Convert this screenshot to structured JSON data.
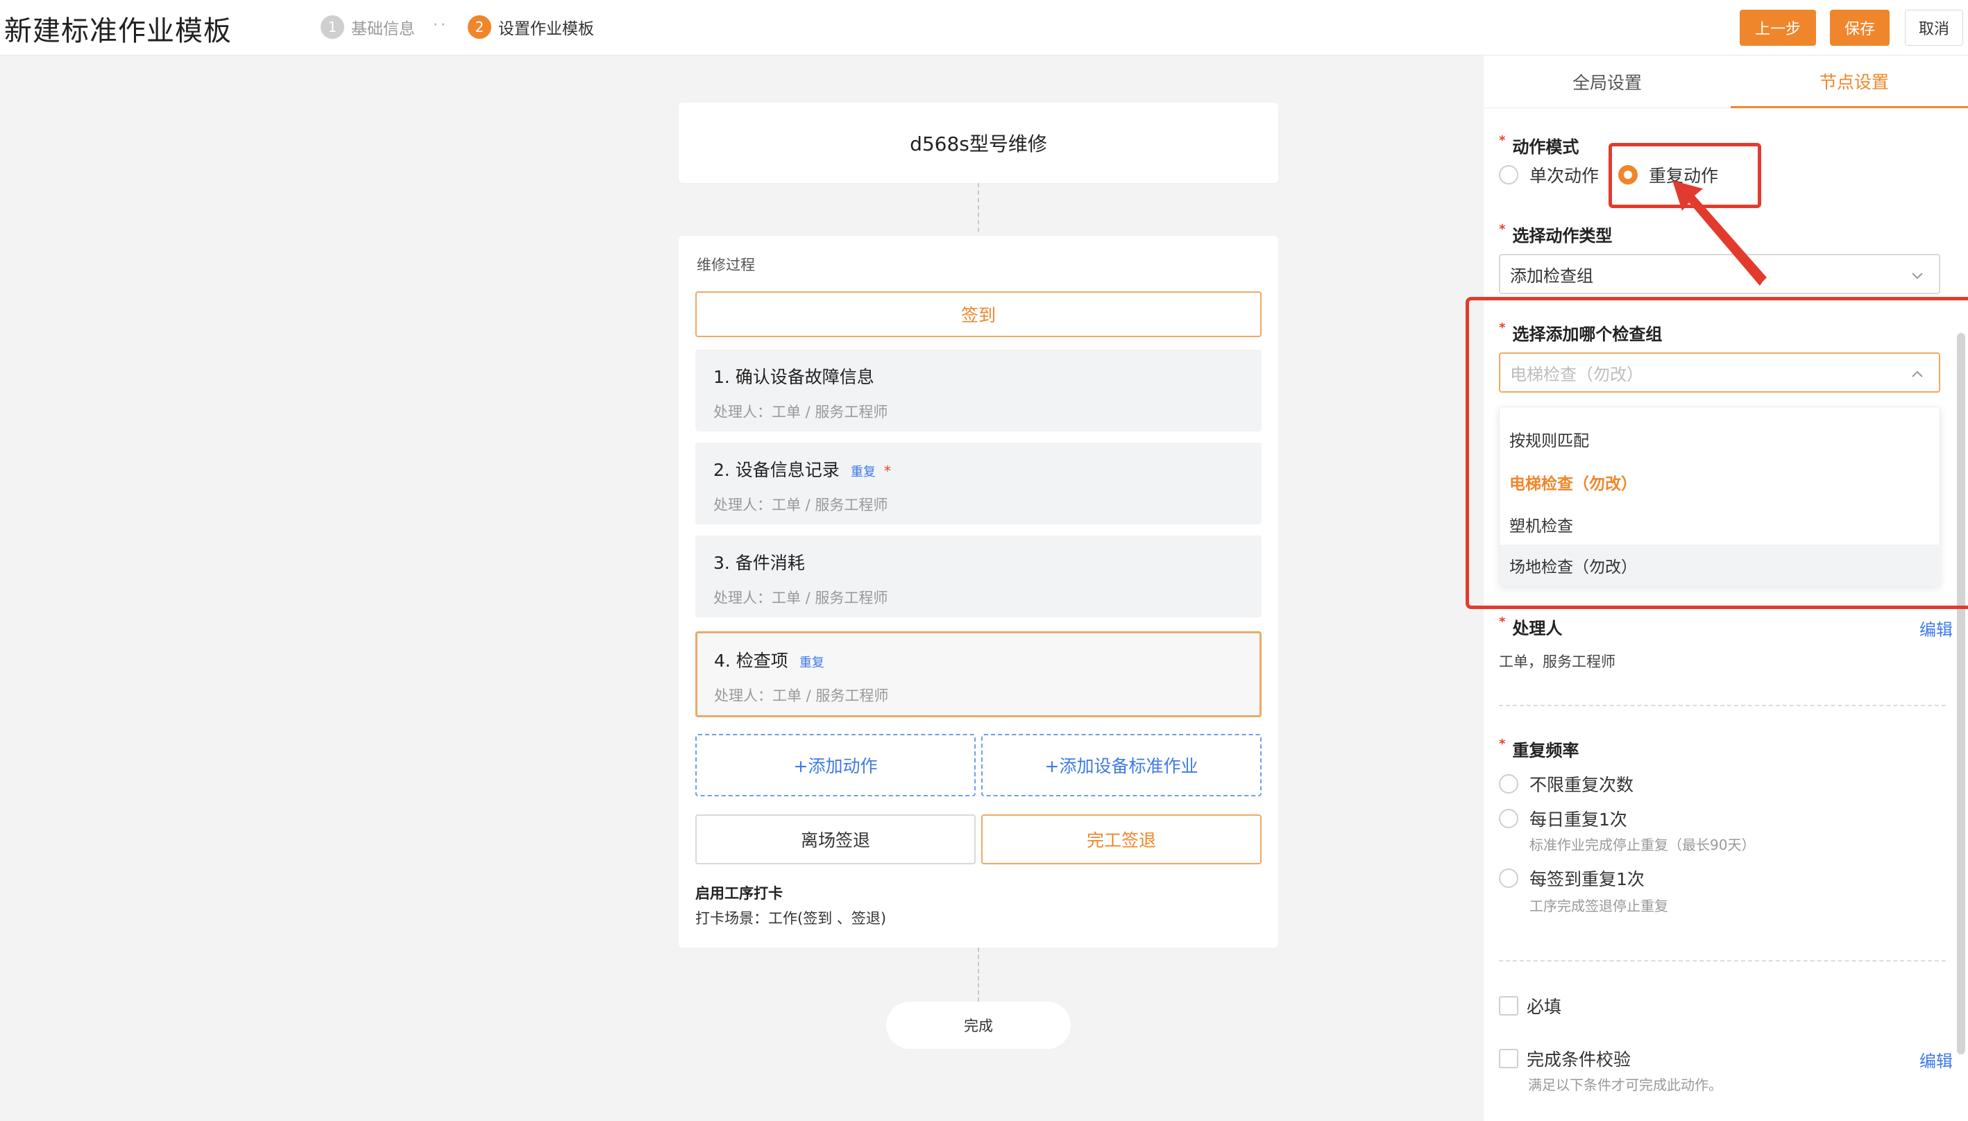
{
  "header": {
    "title": "新建标准作业模板",
    "steps": [
      {
        "num": "1",
        "label": "基础信息"
      },
      {
        "num": "2",
        "label": "设置作业模板"
      }
    ],
    "buttons": {
      "prev": "上一步",
      "save": "保存",
      "cancel": "取消"
    }
  },
  "canvas": {
    "template_name": "d568s型号维修",
    "process_label": "维修过程",
    "signin_label": "签到",
    "items": [
      {
        "name": "1. 确认设备故障信息",
        "tag": "",
        "required": "",
        "handler": "处理人：工单 / 服务工程师"
      },
      {
        "name": "2. 设备信息记录",
        "tag": "重复",
        "required": "*",
        "handler": "处理人：工单 / 服务工程师"
      },
      {
        "name": "3. 备件消耗",
        "tag": "",
        "required": "",
        "handler": "处理人：工单 / 服务工程师"
      },
      {
        "name": "4. 检查项",
        "tag": "重复",
        "required": "",
        "handler": "处理人：工单 / 服务工程师"
      }
    ],
    "add_action": "+添加动作",
    "add_standard": "+添加设备标准作业",
    "leave_checkout": "离场签退",
    "finish_checkout": "完工签退",
    "punch_title": "启用工序打卡",
    "punch_scene": "打卡场景：工作(签到 、签退)",
    "done_label": "完成"
  },
  "panel": {
    "tabs": [
      "全局设置",
      "节点设置"
    ],
    "action_mode": {
      "label": "动作模式",
      "options": [
        "单次动作",
        "重复动作"
      ],
      "selected": "重复动作"
    },
    "action_type": {
      "label": "选择动作类型",
      "value": "添加检查组"
    },
    "check_group": {
      "label": "选择添加哪个检查组",
      "placeholder": "电梯检查（勿改）",
      "options": [
        "按规则匹配",
        "电梯检查（勿改）",
        "塑机检查",
        "场地检查（勿改）"
      ],
      "selected": "电梯检查（勿改）",
      "hovered": "场地检查（勿改）"
    },
    "handler": {
      "label": "处理人",
      "edit": "编辑",
      "value": "工单，服务工程师"
    },
    "frequency": {
      "label": "重复频率",
      "options": [
        {
          "label": "不限重复次数",
          "hint": ""
        },
        {
          "label": "每日重复1次",
          "hint": "标准作业完成停止重复（最长90天）"
        },
        {
          "label": "每签到重复1次",
          "hint": "工序完成签退停止重复"
        }
      ]
    },
    "required_label": "必填",
    "completion_check": {
      "label": "完成条件校验",
      "edit": "编辑",
      "hint": "满足以下条件才可完成此动作。"
    }
  },
  "colors": {
    "accent": "#f0862b",
    "link": "#3d7ae6",
    "annotation": "#e23b2e"
  }
}
